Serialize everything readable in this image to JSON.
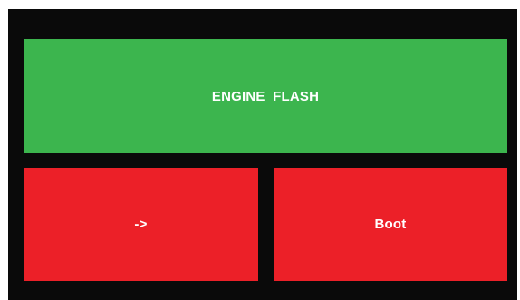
{
  "buttons": {
    "top": {
      "label": "ENGINE_FLASH",
      "color": "#3cb54e"
    },
    "left": {
      "label": "->",
      "color": "#ec2028"
    },
    "right": {
      "label": "Boot",
      "color": "#ec2028"
    }
  },
  "colors": {
    "background": "#0a0a0a",
    "frame": "#ffffff"
  }
}
